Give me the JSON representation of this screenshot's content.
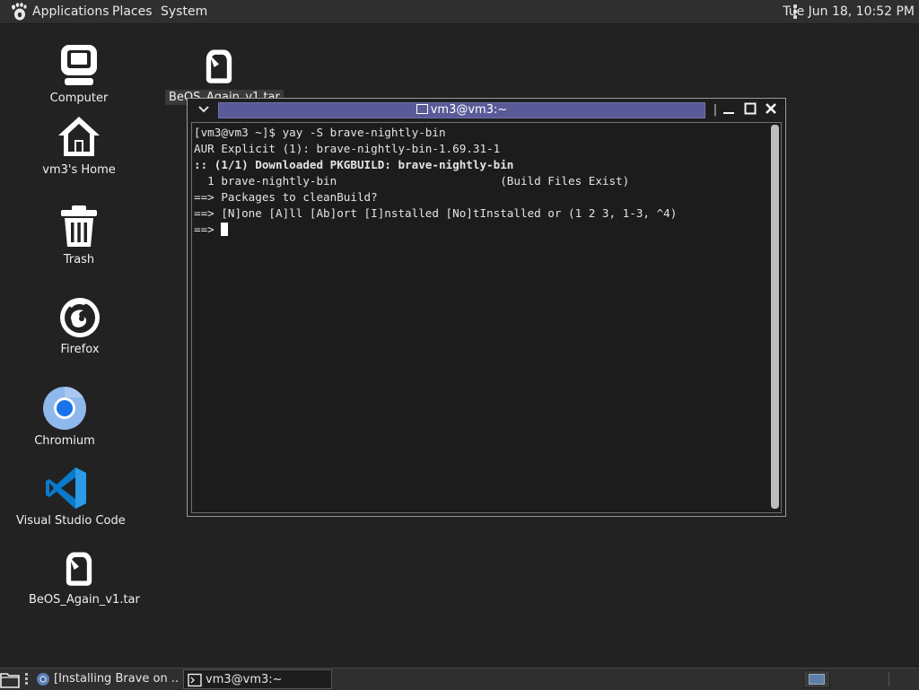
{
  "top_panel": {
    "applications": "Applications",
    "places": "Places",
    "system": "System",
    "clock": "Tue Jun 18, 10:52 PM"
  },
  "desktop_icons": [
    {
      "label": "Computer",
      "icon": "computer-icon"
    },
    {
      "label": "vm3's Home",
      "icon": "home-icon"
    },
    {
      "label": "Trash",
      "icon": "trash-icon"
    },
    {
      "label": "Firefox",
      "icon": "firefox-icon"
    },
    {
      "label": "Chromium",
      "icon": "chromium-icon"
    },
    {
      "label": "Visual Studio Code",
      "icon": "vscode-icon"
    },
    {
      "label": "BeOS_Again_v1.tar",
      "icon": "archive-file-icon"
    },
    {
      "label": "BeOS_Again_v1.tar",
      "icon": "archive-file-icon"
    }
  ],
  "terminal": {
    "title": "vm3@vm3:~",
    "lines": [
      "[vm3@vm3 ~]$ yay -S brave-nightly-bin",
      "AUR Explicit (1): brave-nightly-bin-1.69.31-1",
      ":: (1/1) Downloaded PKGBUILD: brave-nightly-bin",
      "  1 brave-nightly-bin                        (Build Files Exist)",
      "==> Packages to cleanBuild?",
      "==> [N]one [A]ll [Ab]ort [I]nstalled [No]tInstalled or (1 2 3, 1-3, ^4)",
      "==> "
    ]
  },
  "bottom_panel": {
    "tasks": [
      {
        "label": "[Installing Brave on ...",
        "icon": "browser-icon"
      },
      {
        "label": "vm3@vm3:~",
        "icon": "terminal-icon"
      }
    ]
  },
  "colors": {
    "desktop": "#222222",
    "panel": "#2f2f2f",
    "title_strip": "#5a5a98",
    "chromium_blue": "#1a73e8",
    "vscode_blue": "#0a7acc"
  }
}
